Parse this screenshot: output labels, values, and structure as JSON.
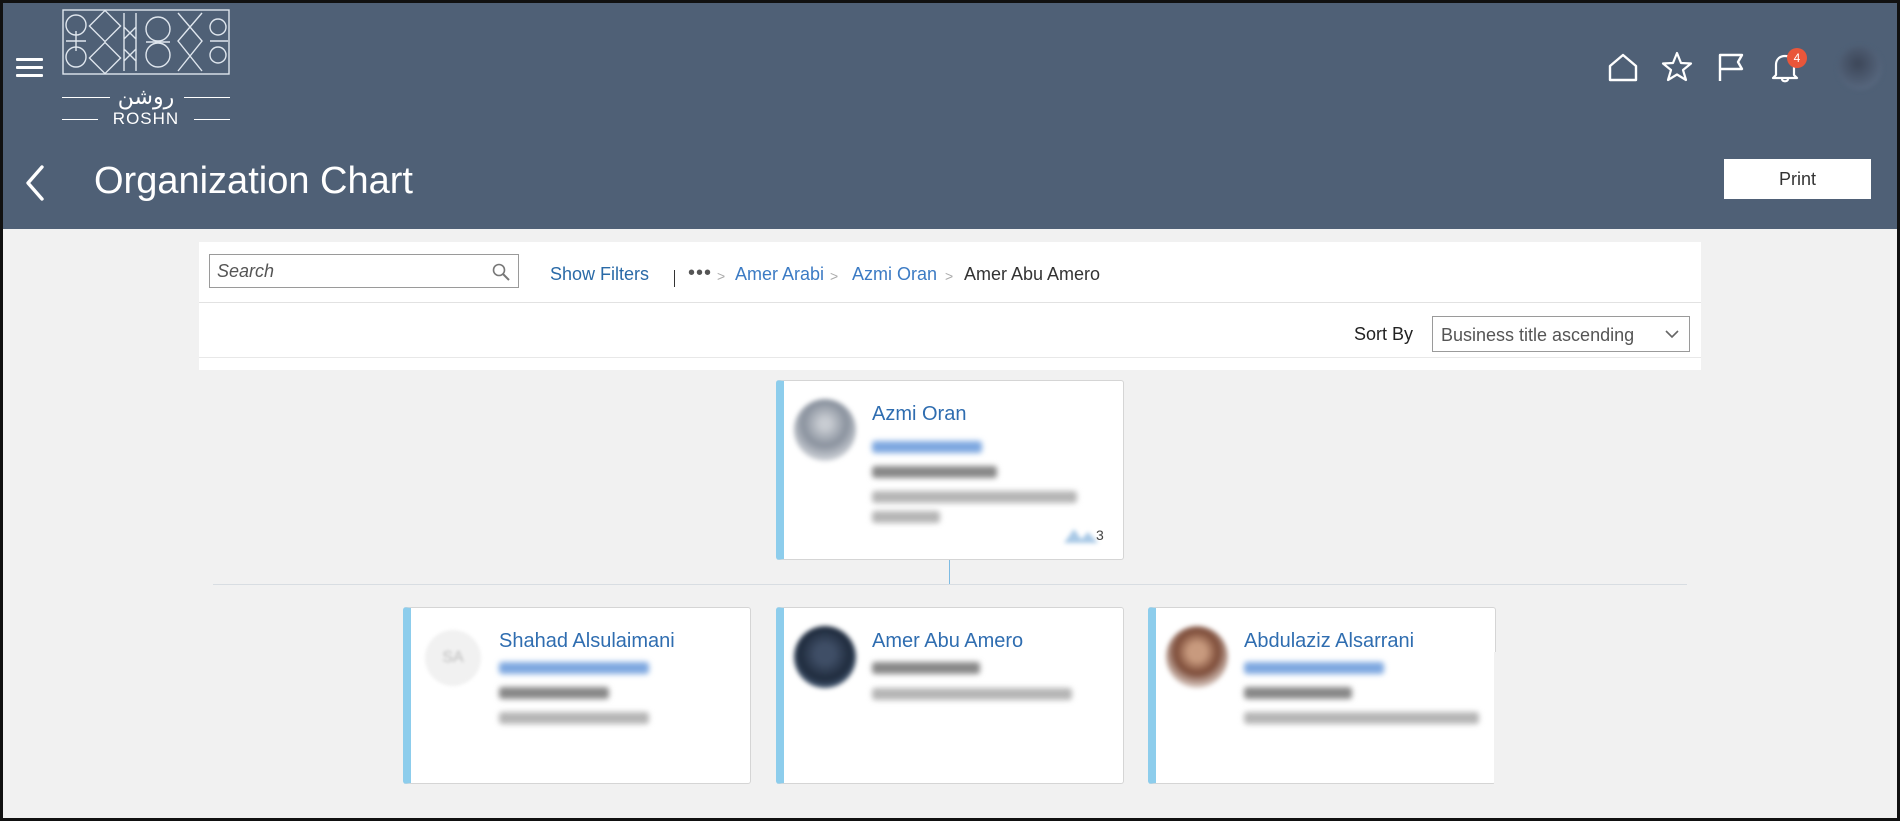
{
  "header": {
    "logo_arabic": "روشن",
    "logo_latin": "ROSHN",
    "notification_count": "4",
    "page_title": "Organization Chart",
    "print_label": "Print"
  },
  "toolbar": {
    "search_placeholder": "Search",
    "show_filters_label": "Show Filters",
    "breadcrumb": {
      "overflow": "•••",
      "separator": ">",
      "items": [
        "Amer Arabi",
        "Azmi Oran",
        "Amer Abu Amero"
      ]
    },
    "sort_by_label": "Sort By",
    "sort_value": "Business title ascending"
  },
  "org": {
    "manager": {
      "name": "Azmi Oran",
      "report_count": "3"
    },
    "reports": [
      {
        "name": "Shahad Alsulaimani",
        "initials": "SA"
      },
      {
        "name": "Amer Abu Amero"
      },
      {
        "name": "Abdulaziz Alsarrani"
      }
    ]
  },
  "colors": {
    "header_bg": "#4f6076",
    "accent_blue": "#2f6db0",
    "card_accent": "#8dcdec",
    "badge": "#e9563a"
  }
}
